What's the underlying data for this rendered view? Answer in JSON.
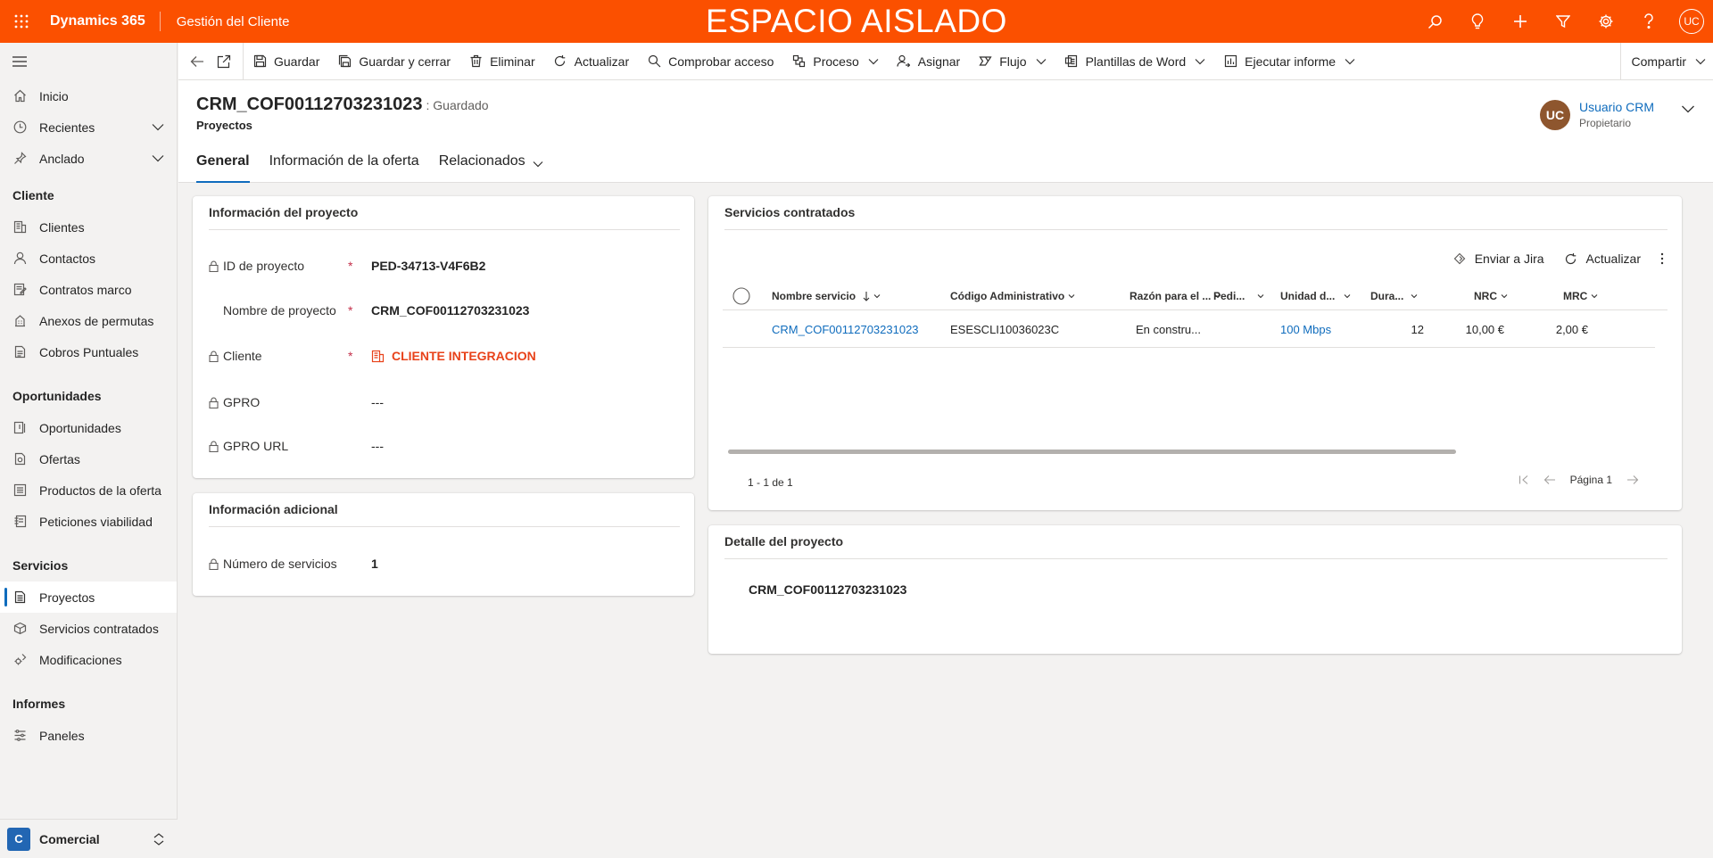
{
  "topbar": {
    "brand": "Dynamics 365",
    "app_name": "Gestión del Cliente",
    "environment_banner": "ESPACIO AISLADO",
    "user_initials": "UC",
    "icons": [
      "search-icon",
      "lightbulb-icon",
      "plus-icon",
      "filter-icon",
      "gear-icon",
      "help-icon"
    ]
  },
  "sidebar": {
    "top_items": [
      {
        "label": "Inicio",
        "icon": "home-icon"
      },
      {
        "label": "Recientes",
        "icon": "clock-icon"
      },
      {
        "label": "Anclado",
        "icon": "pin-icon"
      }
    ],
    "groups": [
      {
        "title": "Cliente",
        "items": [
          "Clientes",
          "Contactos",
          "Contratos marco",
          "Anexos de permutas",
          "Cobros Puntuales"
        ]
      },
      {
        "title": "Oportunidades",
        "items": [
          "Oportunidades",
          "Ofertas",
          "Productos de la oferta",
          "Peticiones viabilidad"
        ]
      },
      {
        "title": "Servicios",
        "items": [
          "Proyectos",
          "Servicios contratados",
          "Modificaciones"
        ]
      },
      {
        "title": "Informes",
        "items": [
          "Paneles"
        ]
      }
    ],
    "selected": "Proyectos",
    "area": {
      "badge": "C",
      "label": "Comercial"
    }
  },
  "commandbar": {
    "commands": [
      "Guardar",
      "Guardar y cerrar",
      "Eliminar",
      "Actualizar",
      "Comprobar acceso",
      "Proceso",
      "Asignar",
      "Flujo",
      "Plantillas de Word",
      "Ejecutar informe"
    ],
    "share": "Compartir"
  },
  "record": {
    "title": "CRM_COF00112703231023",
    "status": ": Guardado",
    "entity": "Proyectos",
    "owner_initials": "UC",
    "owner_name": "Usuario CRM",
    "owner_role": "Propietario"
  },
  "tabs": [
    "General",
    "Información de la oferta",
    "Relacionados"
  ],
  "project_info": {
    "title": "Información del proyecto",
    "fields": [
      {
        "label": "ID de proyecto",
        "value": "PED-34713-V4F6B2",
        "required": "*"
      },
      {
        "label": "Nombre de proyecto",
        "value": "CRM_COF00112703231023",
        "required": "*"
      },
      {
        "label": "Cliente",
        "value": "CLIENTE INTEGRACION",
        "required": "*"
      },
      {
        "label": "GPRO",
        "value": "---",
        "required": ""
      },
      {
        "label": "GPRO URL",
        "value": "---",
        "required": ""
      }
    ]
  },
  "additional_info": {
    "title": "Información adicional",
    "fields": [
      {
        "label": "Número de servicios",
        "value": "1"
      }
    ]
  },
  "services": {
    "title": "Servicios contratados",
    "toolbar": [
      "Enviar a Jira",
      "Actualizar"
    ],
    "columns": [
      "Nombre servicio",
      "Código Administrativo",
      "Razón para el ...",
      "Pedi...",
      "Unidad d...",
      "Dura...",
      "NRC",
      "MRC"
    ],
    "rows": [
      [
        "CRM_COF00112703231023",
        "ESESCLI10036023C",
        "En constru...",
        "",
        "100 Mbps",
        "12",
        "10,00 €",
        "2,00 €"
      ]
    ],
    "count_text": "1 - 1 de 1",
    "page_text": "Página 1"
  },
  "project_detail": {
    "title": "Detalle del proyecto",
    "text": "CRM_COF00112703231023"
  }
}
